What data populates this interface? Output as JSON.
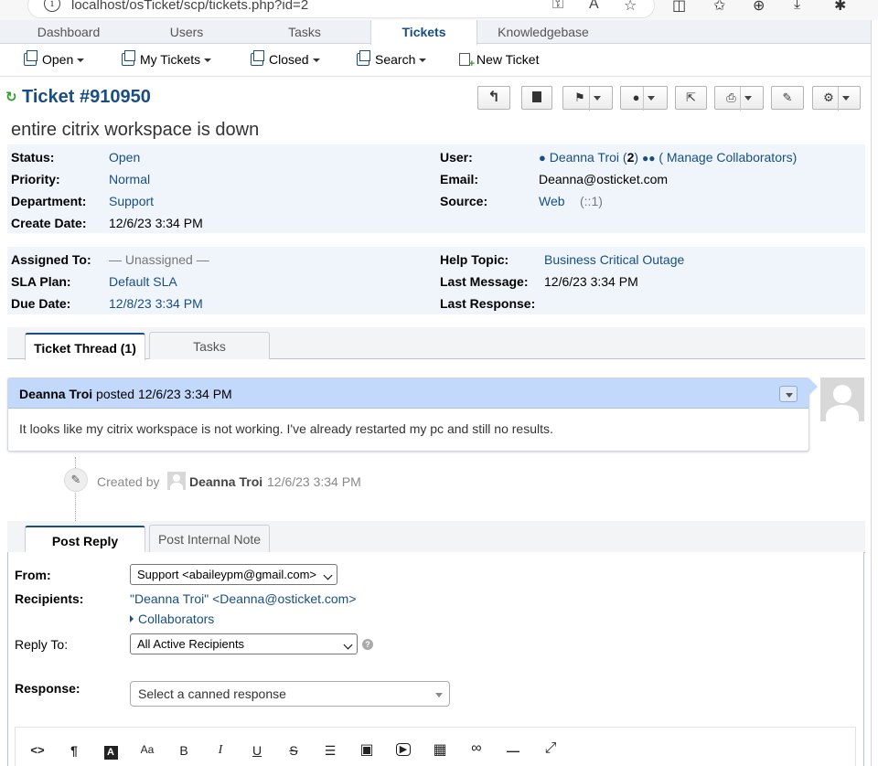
{
  "browser": {
    "url": "localhost/osTicket/scp/tickets.php?id=2",
    "info_icon": "i",
    "toolbar_icons": [
      "key-icon",
      "read-aloud-icon",
      "favorite-star-icon",
      "split-screen-icon",
      "favorites-icon",
      "collections-icon",
      "downloads-icon",
      "extensions-icon"
    ]
  },
  "nav": {
    "tabs": [
      {
        "label": "Dashboard"
      },
      {
        "label": "Users"
      },
      {
        "label": "Tasks"
      },
      {
        "label": "Tickets"
      },
      {
        "label": "Knowledgebase"
      }
    ],
    "active": "Tickets"
  },
  "subnav": {
    "items": [
      {
        "label": "Open",
        "icon": "tickets-icon"
      },
      {
        "label": "My Tickets",
        "icon": "tickets-icon"
      },
      {
        "label": "Closed",
        "icon": "tickets-icon"
      },
      {
        "label": "Search",
        "icon": "tickets-icon"
      },
      {
        "label": "New Ticket",
        "icon": "new-ticket-icon"
      }
    ]
  },
  "ticket": {
    "refresh_icon": "↻",
    "title": "Ticket #910950",
    "subject": "entire citrix workspace is down",
    "actions": [
      "reply-icon",
      "print-pdf-icon",
      "flag-icon",
      "assign-user-icon",
      "transfer-icon",
      "print-icon",
      "edit-icon",
      "settings-icon"
    ]
  },
  "info1": {
    "status_label": "Status:",
    "status": "Open",
    "priority_label": "Priority:",
    "priority": "Normal",
    "department_label": "Department:",
    "department": "Support",
    "create_label": "Create Date:",
    "create_date": "12/6/23 3:34 PM",
    "user_label": "User:",
    "user_name": "Deanna Troi",
    "user_count_open": "(",
    "user_count": "2",
    "user_count_close": ")",
    "manage_collab": "( Manage Collaborators)",
    "email_label": "Email:",
    "email": "Deanna@osticket.com",
    "source_label": "Source:",
    "source": "Web",
    "source_ip": "(::1)"
  },
  "info2": {
    "assigned_label": "Assigned To:",
    "assigned": "— Unassigned —",
    "sla_label": "SLA Plan:",
    "sla": "Default SLA",
    "due_label": "Due Date:",
    "due": "12/8/23 3:34 PM",
    "topic_label": "Help Topic:",
    "topic": "Business Critical Outage",
    "last_msg_label": "Last Message:",
    "last_msg": "12/6/23 3:34 PM",
    "last_resp_label": "Last Response:",
    "last_resp": ""
  },
  "thread_tabs": [
    {
      "label": "Ticket Thread (1)"
    },
    {
      "label": "Tasks"
    }
  ],
  "message": {
    "author": "Deanna Troi",
    "posted": "posted 12/6/23 3:34 PM",
    "body": "It looks like my citrix workspace is not working. I've already restarted my pc and still no results."
  },
  "event": {
    "icon": "✎",
    "created_by": "Created by",
    "author": "Deanna Troi",
    "time": "12/6/23 3:34 PM"
  },
  "reply_tabs": [
    {
      "label": "Post Reply"
    },
    {
      "label": "Post Internal Note"
    }
  ],
  "reply": {
    "from_label": "From:",
    "from_value": "Support <abaileypm@gmail.com>",
    "recipients_label": "Recipients:",
    "recipients_value": "\"Deanna Troi\" <Deanna@osticket.com>",
    "collaborators": "Collaborators",
    "reply_to_label": "Reply To:",
    "reply_to_value": "All Active Recipients",
    "help_icon": "?",
    "response_label": "Response:",
    "canned_placeholder": "Select a canned response"
  },
  "editor_toolbar": {
    "tools": [
      {
        "name": "html-code-icon",
        "glyph": "<>"
      },
      {
        "name": "paragraph-icon",
        "glyph": "¶"
      },
      {
        "name": "text-color-icon",
        "glyph": "A"
      },
      {
        "name": "font-size-icon",
        "glyph": "Aa"
      },
      {
        "name": "bold-icon",
        "glyph": "B"
      },
      {
        "name": "italic-icon",
        "glyph": "I"
      },
      {
        "name": "underline-icon",
        "glyph": "U"
      },
      {
        "name": "strikethrough-icon",
        "glyph": "S"
      },
      {
        "name": "list-icon",
        "glyph": "☰"
      },
      {
        "name": "image-icon",
        "glyph": "▣"
      },
      {
        "name": "video-icon",
        "glyph": "▶"
      },
      {
        "name": "table-icon",
        "glyph": "▦"
      },
      {
        "name": "link-icon",
        "glyph": "∞"
      },
      {
        "name": "horizontal-rule-icon",
        "glyph": "—"
      },
      {
        "name": "fullscreen-icon",
        "glyph": "⤢"
      }
    ]
  }
}
